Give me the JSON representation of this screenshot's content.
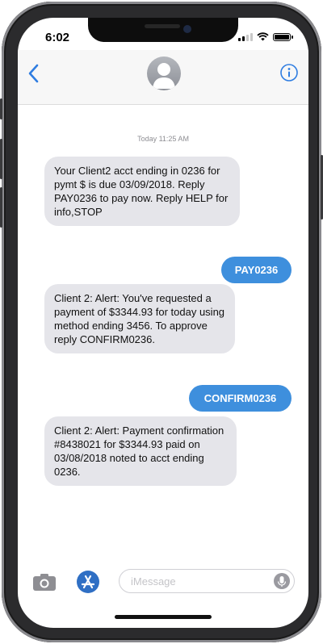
{
  "status_bar": {
    "time": "6:02"
  },
  "header": {
    "back_icon": "chevron-left-icon",
    "avatar_icon": "person-silhouette-icon",
    "info_icon": "info-circle-icon"
  },
  "conversation": {
    "timestamp": "Today 11:25 AM",
    "messages": [
      {
        "direction": "incoming",
        "text": "Your Client2 acct ending in 0236 for pymt $ is due 03/09/2018. Reply PAY0236 to pay now. Reply HELP for info,STOP"
      },
      {
        "direction": "outgoing",
        "text": "PAY0236"
      },
      {
        "direction": "incoming",
        "text": "Client 2: Alert: You've requested a payment of $3344.93 for today using method ending 3456. To approve reply CONFIRM0236."
      },
      {
        "direction": "outgoing",
        "text": "CONFIRM0236"
      },
      {
        "direction": "incoming",
        "text": "Client 2: Alert: Payment confirmation #8438021 for $3344.93 paid on 03/08/2018 noted to acct ending 0236."
      }
    ]
  },
  "input_bar": {
    "placeholder": "iMessage",
    "camera_icon": "camera-icon",
    "apps_icon": "app-store-icon",
    "mic_icon": "microphone-icon"
  },
  "colors": {
    "outgoing_bubble": "#3e8fdd",
    "incoming_bubble": "#e5e5ea",
    "accent": "#2f7de1"
  }
}
